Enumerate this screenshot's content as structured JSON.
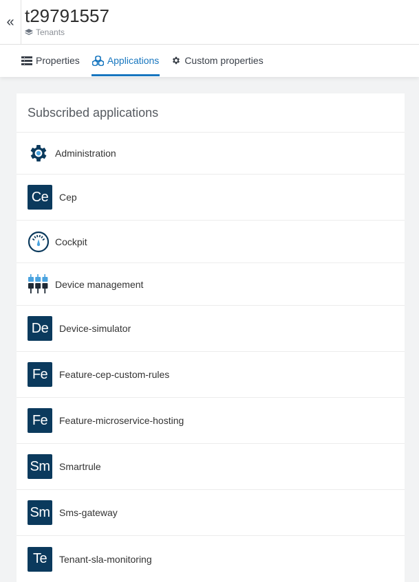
{
  "header": {
    "back_label": "«",
    "title": "t29791557",
    "breadcrumb": "Tenants"
  },
  "tabs": [
    {
      "label": "Properties",
      "icon": "list-icon"
    },
    {
      "label": "Applications",
      "icon": "cubes-icon",
      "active": true
    },
    {
      "label": "Custom properties",
      "icon": "gear-icon"
    }
  ],
  "card": {
    "title": "Subscribed applications",
    "apps": [
      {
        "label": "Administration",
        "icon": "gear-icon"
      },
      {
        "label": "Cep",
        "badge": "Ce"
      },
      {
        "label": "Cockpit",
        "icon": "gauge-icon"
      },
      {
        "label": "Device management",
        "icon": "plugs-icon"
      },
      {
        "label": "Device-simulator",
        "badge": "De"
      },
      {
        "label": "Feature-cep-custom-rules",
        "badge": "Fe"
      },
      {
        "label": "Feature-microservice-hosting",
        "badge": "Fe"
      },
      {
        "label": "Smartrule",
        "badge": "Sm"
      },
      {
        "label": "Sms-gateway",
        "badge": "Sm"
      },
      {
        "label": "Tenant-sla-monitoring",
        "badge": "Te"
      }
    ]
  },
  "colors": {
    "accent": "#1776bf",
    "app_badge": "#0b3a5d",
    "device_mgmt_light": "#4aa3df"
  }
}
